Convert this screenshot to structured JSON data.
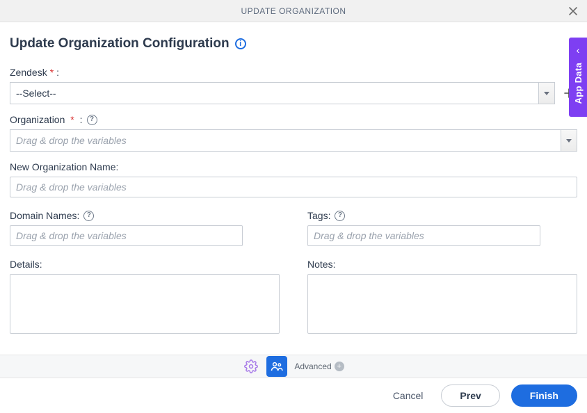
{
  "titlebar": {
    "title": "UPDATE ORGANIZATION"
  },
  "heading": "Update Organization Configuration",
  "side_panel": {
    "label": "App Data"
  },
  "fields": {
    "zendesk": {
      "label": "Zendesk",
      "value": "--Select--"
    },
    "organization": {
      "label": "Organization",
      "placeholder": "Drag & drop the variables"
    },
    "new_org_name": {
      "label": "New Organization Name:",
      "placeholder": "Drag & drop the variables"
    },
    "domain_names": {
      "label": "Domain Names:",
      "placeholder": "Drag & drop the variables"
    },
    "tags": {
      "label": "Tags:",
      "placeholder": "Drag & drop the variables"
    },
    "details": {
      "label": "Details:"
    },
    "notes": {
      "label": "Notes:"
    }
  },
  "tabstrip": {
    "advanced_label": "Advanced"
  },
  "footer": {
    "cancel": "Cancel",
    "prev": "Prev",
    "finish": "Finish"
  }
}
